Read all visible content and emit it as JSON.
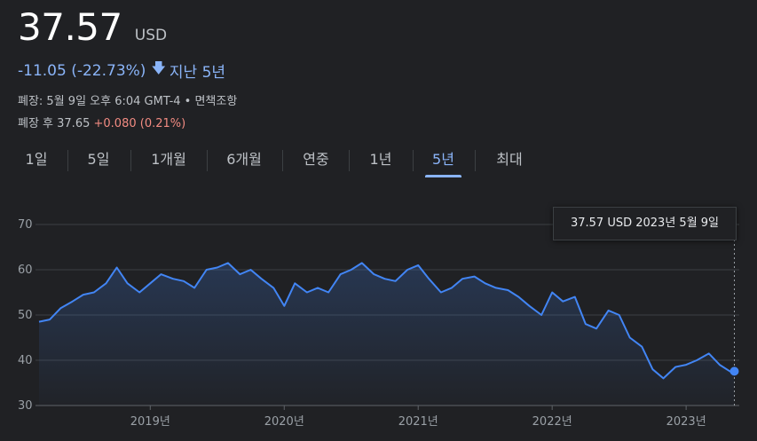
{
  "quote": {
    "price": "37.57",
    "currency": "USD",
    "change": "-11.05 (-22.73%)",
    "change_period": "지난 5년",
    "closed_info": "폐장: 5월 9일 오후 6:04 GMT-4 • 면책조항",
    "after_hours_label": "폐장 후 37.65",
    "after_hours_change": "+0.080 (0.21%)"
  },
  "tabs": [
    {
      "label": "1일",
      "active": false
    },
    {
      "label": "5일",
      "active": false
    },
    {
      "label": "1개월",
      "active": false
    },
    {
      "label": "6개월",
      "active": false
    },
    {
      "label": "연중",
      "active": false
    },
    {
      "label": "1년",
      "active": false
    },
    {
      "label": "5년",
      "active": true
    },
    {
      "label": "최대",
      "active": false
    }
  ],
  "tooltip": {
    "text": "37.57 USD  2023년 5월 9일"
  },
  "colors": {
    "line": "#4285f4",
    "accent": "#8ab4f8",
    "positive": "#f28b82"
  },
  "chart_data": {
    "type": "area",
    "title": "",
    "xlabel": "",
    "ylabel": "",
    "ylim": [
      30,
      70
    ],
    "yticks": [
      30,
      40,
      50,
      60,
      70
    ],
    "xticks": [
      {
        "label": "2019년",
        "x": 2019.0
      },
      {
        "label": "2020년",
        "x": 2020.0
      },
      {
        "label": "2021년",
        "x": 2021.0
      },
      {
        "label": "2022년",
        "x": 2022.0
      },
      {
        "label": "2023년",
        "x": 2023.0
      }
    ],
    "xlim": [
      2018.17,
      2023.37
    ],
    "grid": true,
    "series": [
      {
        "x": [
          2018.17,
          2018.25,
          2018.33,
          2018.42,
          2018.5,
          2018.58,
          2018.67,
          2018.75,
          2018.83,
          2018.92,
          2019.0,
          2019.08,
          2019.17,
          2019.25,
          2019.33,
          2019.42,
          2019.5,
          2019.58,
          2019.67,
          2019.75,
          2019.83,
          2019.92,
          2020.0,
          2020.08,
          2020.17,
          2020.25,
          2020.33,
          2020.42,
          2020.5,
          2020.58,
          2020.67,
          2020.75,
          2020.83,
          2020.92,
          2021.0,
          2021.08,
          2021.17,
          2021.25,
          2021.33,
          2021.42,
          2021.5,
          2021.58,
          2021.67,
          2021.75,
          2021.83,
          2021.92,
          2022.0,
          2022.08,
          2022.17,
          2022.25,
          2022.33,
          2022.42,
          2022.5,
          2022.58,
          2022.67,
          2022.75,
          2022.83,
          2022.92,
          2023.0,
          2023.08,
          2023.17,
          2023.25,
          2023.33,
          2023.36
        ],
        "y": [
          48.5,
          49,
          51.5,
          53,
          54.5,
          55,
          57,
          60.5,
          57,
          55,
          57,
          59,
          58,
          57.5,
          56,
          60,
          60.5,
          61.5,
          59,
          60,
          58,
          56,
          52,
          57,
          55,
          56,
          55,
          59,
          60,
          61.5,
          59,
          58,
          57.5,
          60,
          61,
          58,
          55,
          56,
          58,
          58.5,
          57,
          56,
          55.5,
          54,
          52,
          50,
          55,
          53,
          54,
          48,
          47,
          51,
          50,
          45,
          43,
          38,
          36,
          38.5,
          39,
          40,
          41.5,
          39,
          37.5,
          37.57
        ]
      }
    ]
  }
}
